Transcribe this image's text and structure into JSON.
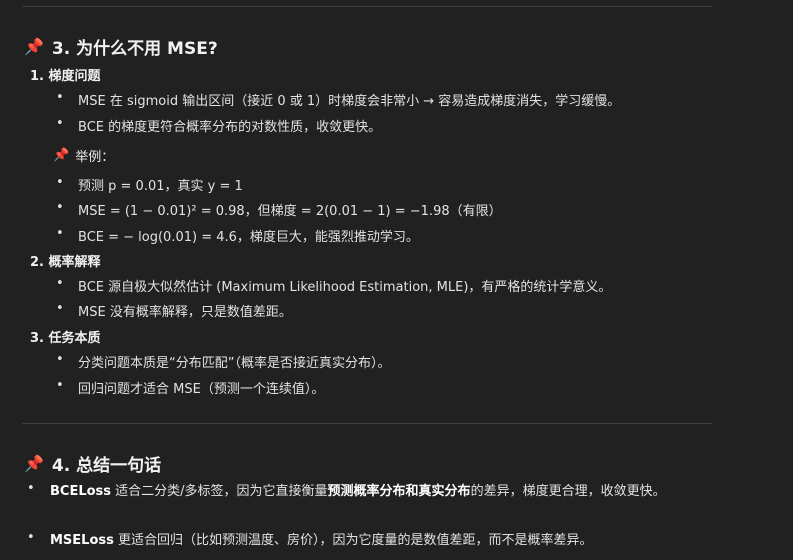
{
  "section3": {
    "title": "3. 为什么不用 MSE?",
    "groups": [
      {
        "heading": "1. 梯度问题",
        "items": [
          "MSE 在 sigmoid 输出区间（接近 0 或 1）时梯度会非常小 → 容易造成梯度消失，学习缓慢。",
          "BCE 的梯度更符合概率分布的对数性质，收敛更快。"
        ],
        "example_heading": "举例：",
        "examples": [
          "预测 p = 0.01，真实 y = 1",
          "MSE = (1 − 0.01)² = 0.98，但梯度 = 2(0.01 − 1) = −1.98（有限）",
          "BCE = − log(0.01) = 4.6，梯度巨大，能强烈推动学习。"
        ]
      },
      {
        "heading": "2. 概率解释",
        "items": [
          "BCE 源自极大似然估计 (Maximum Likelihood Estimation, MLE)，有严格的统计学意义。",
          "MSE 没有概率解释，只是数值差距。"
        ]
      },
      {
        "heading": "3. 任务本质",
        "items": [
          "分类问题本质是“分布匹配”（概率是否接近真实分布）。",
          "回归问题才适合 MSE（预测一个连续值）。"
        ]
      }
    ]
  },
  "section4": {
    "title": "4. 总结一句话",
    "items": [
      {
        "bold": "BCELoss",
        "text": " 适合二分类/多标签，因为它直接衡量",
        "bold2": "预测概率分布和真实分布",
        "text2": "的差异，梯度更合理，收敛更快。"
      },
      {
        "bold": "MSELoss",
        "text": " 更适合回归（比如预测温度、房价），因为它度量的是数值差距，而不是概率差异。"
      }
    ]
  },
  "icons": {
    "pin": "pushpin-icon"
  },
  "colors": {
    "background": "#212121",
    "pin": "#e8465c",
    "text": "#ececec"
  }
}
